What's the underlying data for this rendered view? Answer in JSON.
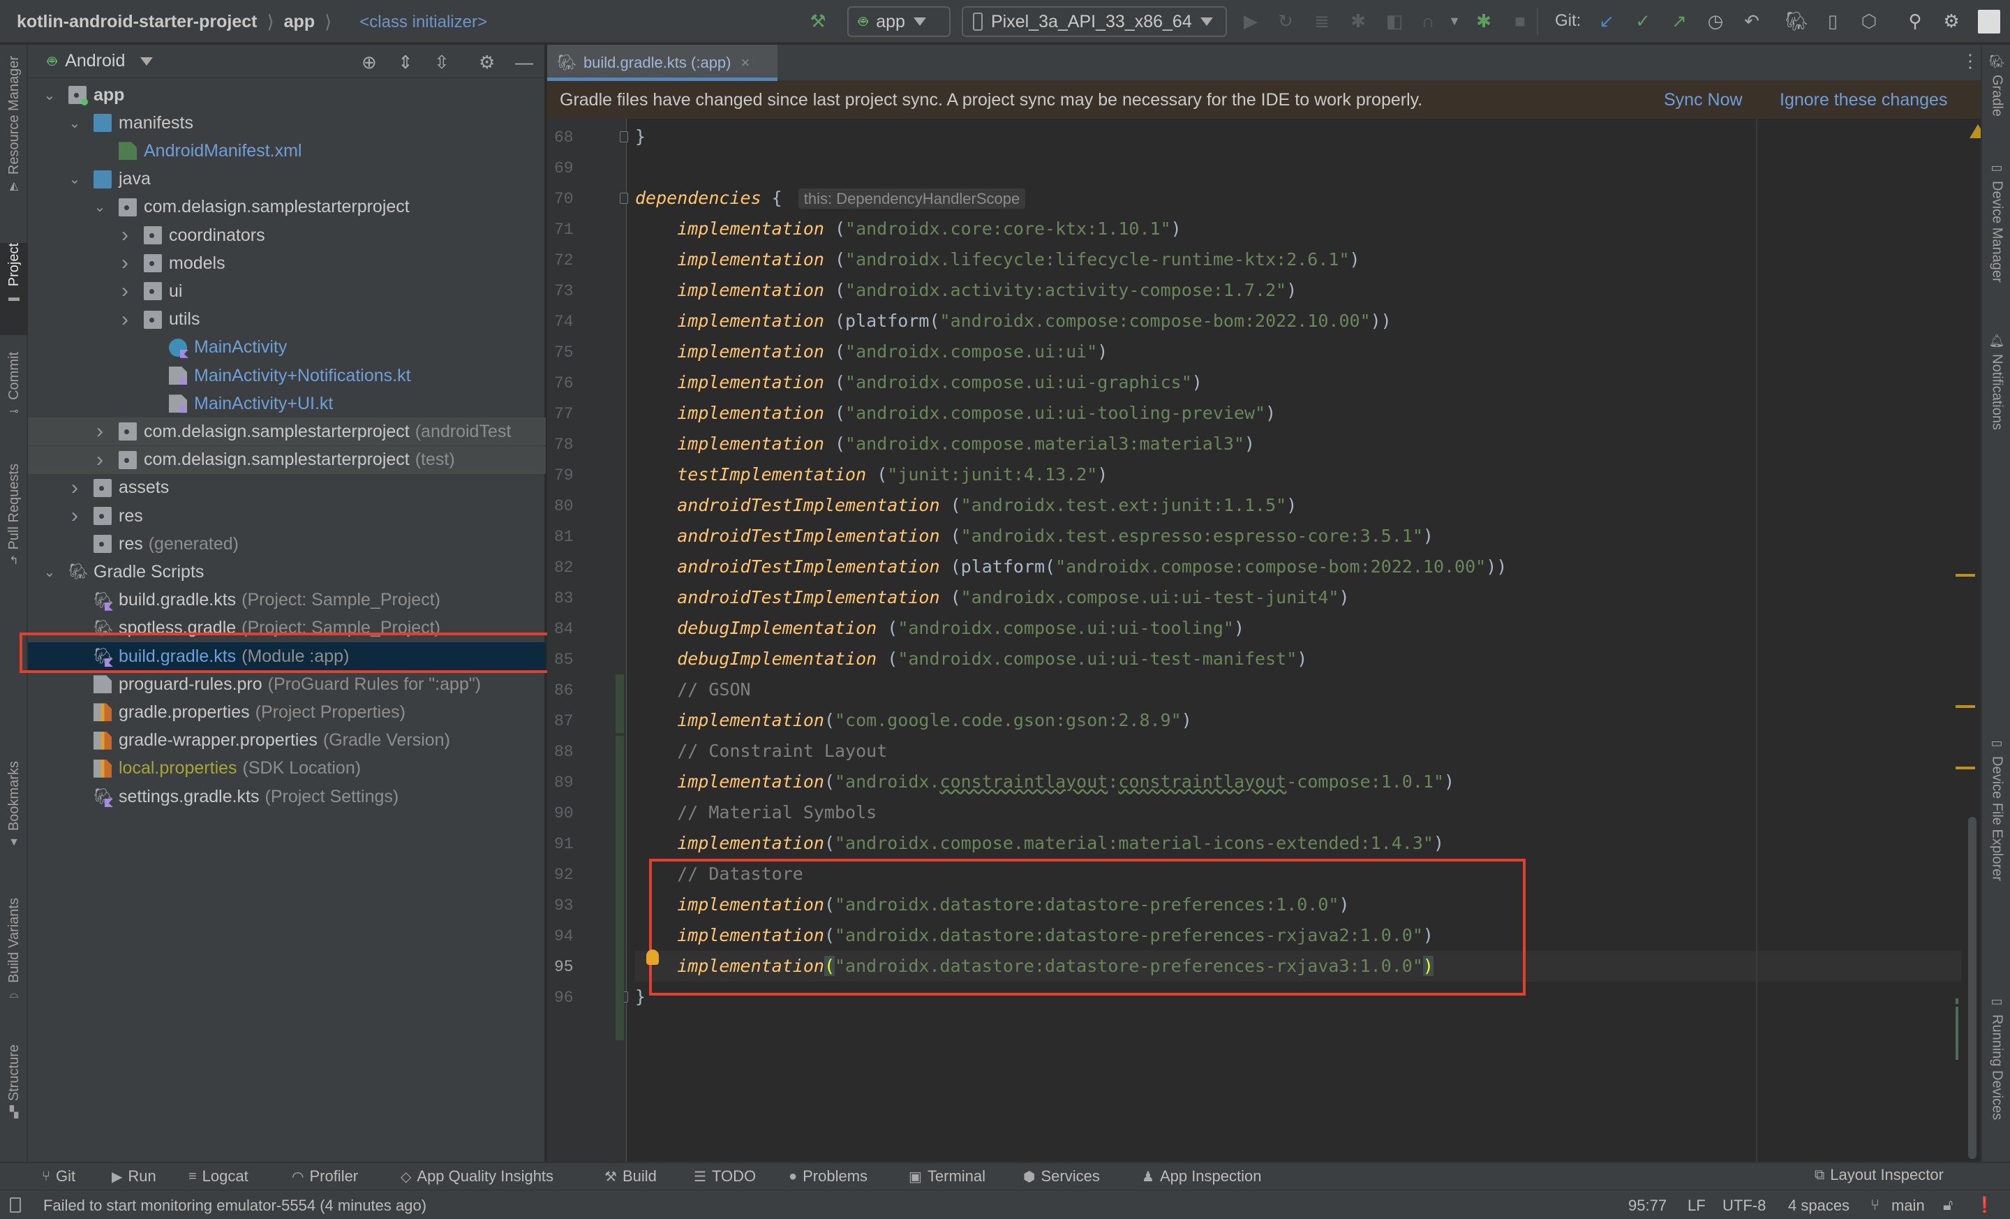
{
  "toolbar": {
    "breadcrumbs": [
      "kotlin-android-starter-project",
      "app"
    ],
    "context": "<class initializer>",
    "run_config": "app",
    "device": "Pixel_3a_API_33_x86_64",
    "git_label": "Git:",
    "icons": [
      "hammer-icon",
      "run-icon",
      "rerun-icon",
      "apply-changes-icon",
      "debug-icon",
      "profile-icon",
      "attach-icon",
      "stop-icon",
      "git-update-icon",
      "git-commit-icon",
      "git-push-icon",
      "history-icon",
      "rollback-icon",
      "gradle-sync-icon",
      "device-manager-icon",
      "sdk-manager-icon",
      "search-icon",
      "settings-icon",
      "avatar"
    ]
  },
  "left_strip": [
    "Resource Manager",
    "Project",
    "Commit",
    "Pull Requests",
    "Bookmarks",
    "Build Variants",
    "Structure"
  ],
  "right_strip": [
    "Gradle",
    "Device Manager",
    "Notifications",
    "Device File Explorer",
    "Running Devices"
  ],
  "project": {
    "view": "Android",
    "tree": [
      {
        "label": "app",
        "sub": "",
        "depth": 0,
        "chev": "down",
        "icon": "module",
        "bold": true
      },
      {
        "label": "manifests",
        "sub": "",
        "depth": 1,
        "chev": "down",
        "icon": "folder"
      },
      {
        "label": "AndroidManifest.xml",
        "sub": "",
        "depth": 2,
        "chev": "",
        "icon": "manifest",
        "style": "blue"
      },
      {
        "label": "java",
        "sub": "",
        "depth": 1,
        "chev": "down",
        "icon": "folder"
      },
      {
        "label": "com.delasign.samplestarterproject",
        "sub": "",
        "depth": 2,
        "chev": "down",
        "icon": "package"
      },
      {
        "label": "coordinators",
        "sub": "",
        "depth": 3,
        "chev": "right",
        "icon": "package"
      },
      {
        "label": "models",
        "sub": "",
        "depth": 3,
        "chev": "right",
        "icon": "package"
      },
      {
        "label": "ui",
        "sub": "",
        "depth": 3,
        "chev": "right",
        "icon": "package"
      },
      {
        "label": "utils",
        "sub": "",
        "depth": 3,
        "chev": "right",
        "icon": "package"
      },
      {
        "label": "MainActivity",
        "sub": "",
        "depth": 4,
        "chev": "",
        "icon": "kotlin-class",
        "style": "blue"
      },
      {
        "label": "MainActivity+Notifications.kt",
        "sub": "",
        "depth": 4,
        "chev": "",
        "icon": "kotlin-file",
        "style": "blue"
      },
      {
        "label": "MainActivity+UI.kt",
        "sub": "",
        "depth": 4,
        "chev": "",
        "icon": "kotlin-file",
        "style": "blue"
      },
      {
        "label": "com.delasign.samplestarterproject",
        "sub": "(androidTest",
        "depth": 2,
        "chev": "right",
        "icon": "package",
        "shaded": true
      },
      {
        "label": "com.delasign.samplestarterproject",
        "sub": "(test)",
        "depth": 2,
        "chev": "right",
        "icon": "package",
        "shaded": true
      },
      {
        "label": "assets",
        "sub": "",
        "depth": 1,
        "chev": "right",
        "icon": "res-folder"
      },
      {
        "label": "res",
        "sub": "",
        "depth": 1,
        "chev": "right",
        "icon": "res-folder"
      },
      {
        "label": "res",
        "sub": "(generated)",
        "depth": 1,
        "chev": "",
        "icon": "res-folder"
      },
      {
        "label": "Gradle Scripts",
        "sub": "",
        "depth": 0,
        "chev": "down",
        "icon": "gradle"
      },
      {
        "label": "build.gradle.kts",
        "sub": "(Project: Sample_Project)",
        "depth": 1,
        "chev": "",
        "icon": "gradle-kts"
      },
      {
        "label": "spotless.gradle",
        "sub": "(Project: Sample_Project)",
        "depth": 1,
        "chev": "",
        "icon": "gradle"
      },
      {
        "label": "build.gradle.kts",
        "sub": "(Module :app)",
        "depth": 1,
        "chev": "",
        "icon": "gradle-kts",
        "selected": true,
        "style": "blue"
      },
      {
        "label": "proguard-rules.pro",
        "sub": "(ProGuard Rules for \":app\")",
        "depth": 1,
        "chev": "",
        "icon": "text-file"
      },
      {
        "label": "gradle.properties",
        "sub": "(Project Properties)",
        "depth": 1,
        "chev": "",
        "icon": "properties"
      },
      {
        "label": "gradle-wrapper.properties",
        "sub": "(Gradle Version)",
        "depth": 1,
        "chev": "",
        "icon": "properties"
      },
      {
        "label": "local.properties",
        "sub": "(SDK Location)",
        "depth": 1,
        "chev": "",
        "icon": "properties",
        "style": "olive"
      },
      {
        "label": "settings.gradle.kts",
        "sub": "(Project Settings)",
        "depth": 1,
        "chev": "",
        "icon": "gradle-kts"
      }
    ]
  },
  "editor": {
    "tab": "build.gradle.kts (:app)",
    "banner": {
      "message": "Gradle files have changed since last project sync. A project sync may be necessary for the IDE to work properly.",
      "sync_now": "Sync Now",
      "ignore": "Ignore these changes"
    },
    "current_line": 95,
    "lines": [
      {
        "n": 68,
        "parts": [
          [
            "p",
            "}"
          ]
        ]
      },
      {
        "n": 69,
        "parts": []
      },
      {
        "n": 70,
        "parts": [
          [
            "kw",
            "dependencies"
          ],
          [
            "p",
            " { "
          ],
          [
            "hint",
            "this: DependencyHandlerScope"
          ]
        ]
      },
      {
        "n": 71,
        "parts": [
          [
            "p",
            "    "
          ],
          [
            "kw",
            "implementation"
          ],
          [
            "p",
            " ("
          ],
          [
            "str",
            "\"androidx.core:core-ktx:1.10.1\""
          ],
          [
            "p",
            ")"
          ]
        ]
      },
      {
        "n": 72,
        "parts": [
          [
            "p",
            "    "
          ],
          [
            "kw",
            "implementation"
          ],
          [
            "p",
            " ("
          ],
          [
            "str",
            "\"androidx.lifecycle:lifecycle-runtime-ktx:2.6.1\""
          ],
          [
            "p",
            ")"
          ]
        ]
      },
      {
        "n": 73,
        "parts": [
          [
            "p",
            "    "
          ],
          [
            "kw",
            "implementation"
          ],
          [
            "p",
            " ("
          ],
          [
            "str",
            "\"androidx.activity:activity-compose:1.7.2\""
          ],
          [
            "p",
            ")"
          ]
        ]
      },
      {
        "n": 74,
        "parts": [
          [
            "p",
            "    "
          ],
          [
            "kw",
            "implementation"
          ],
          [
            "p",
            " (platform("
          ],
          [
            "str",
            "\"androidx.compose:compose-bom:2022.10.00\""
          ],
          [
            "p",
            "))"
          ]
        ]
      },
      {
        "n": 75,
        "parts": [
          [
            "p",
            "    "
          ],
          [
            "kw",
            "implementation"
          ],
          [
            "p",
            " ("
          ],
          [
            "str",
            "\"androidx.compose.ui:ui\""
          ],
          [
            "p",
            ")"
          ]
        ]
      },
      {
        "n": 76,
        "parts": [
          [
            "p",
            "    "
          ],
          [
            "kw",
            "implementation"
          ],
          [
            "p",
            " ("
          ],
          [
            "str",
            "\"androidx.compose.ui:ui-graphics\""
          ],
          [
            "p",
            ")"
          ]
        ]
      },
      {
        "n": 77,
        "parts": [
          [
            "p",
            "    "
          ],
          [
            "kw",
            "implementation"
          ],
          [
            "p",
            " ("
          ],
          [
            "str",
            "\"androidx.compose.ui:ui-tooling-preview\""
          ],
          [
            "p",
            ")"
          ]
        ]
      },
      {
        "n": 78,
        "parts": [
          [
            "p",
            "    "
          ],
          [
            "kw",
            "implementation"
          ],
          [
            "p",
            " ("
          ],
          [
            "str",
            "\"androidx.compose.material3:material3\""
          ],
          [
            "p",
            ")"
          ]
        ]
      },
      {
        "n": 79,
        "parts": [
          [
            "p",
            "    "
          ],
          [
            "kw",
            "testImplementation"
          ],
          [
            "p",
            " ("
          ],
          [
            "str",
            "\"junit:junit:4.13.2\""
          ],
          [
            "p",
            ")"
          ]
        ]
      },
      {
        "n": 80,
        "parts": [
          [
            "p",
            "    "
          ],
          [
            "kw",
            "androidTestImplementation"
          ],
          [
            "p",
            " ("
          ],
          [
            "str",
            "\"androidx.test.ext:junit:1.1.5\""
          ],
          [
            "p",
            ")"
          ]
        ]
      },
      {
        "n": 81,
        "parts": [
          [
            "p",
            "    "
          ],
          [
            "kw",
            "androidTestImplementation"
          ],
          [
            "p",
            " ("
          ],
          [
            "str",
            "\"androidx.test.espresso:espresso-core:3.5.1\""
          ],
          [
            "p",
            ")"
          ]
        ]
      },
      {
        "n": 82,
        "parts": [
          [
            "p",
            "    "
          ],
          [
            "kw",
            "androidTestImplementation"
          ],
          [
            "p",
            " (platform("
          ],
          [
            "str",
            "\"androidx.compose:compose-bom:2022.10.00\""
          ],
          [
            "p",
            "))"
          ]
        ]
      },
      {
        "n": 83,
        "parts": [
          [
            "p",
            "    "
          ],
          [
            "kw",
            "androidTestImplementation"
          ],
          [
            "p",
            " ("
          ],
          [
            "str",
            "\"androidx.compose.ui:ui-test-junit4\""
          ],
          [
            "p",
            ")"
          ]
        ]
      },
      {
        "n": 84,
        "parts": [
          [
            "p",
            "    "
          ],
          [
            "kw",
            "debugImplementation"
          ],
          [
            "p",
            " ("
          ],
          [
            "str",
            "\"androidx.compose.ui:ui-tooling\""
          ],
          [
            "p",
            ")"
          ]
        ]
      },
      {
        "n": 85,
        "parts": [
          [
            "p",
            "    "
          ],
          [
            "kw",
            "debugImplementation"
          ],
          [
            "p",
            " ("
          ],
          [
            "str",
            "\"androidx.compose.ui:ui-test-manifest\""
          ],
          [
            "p",
            ")"
          ]
        ]
      },
      {
        "n": 86,
        "parts": [
          [
            "p",
            "    "
          ],
          [
            "cmt",
            "// GSON"
          ]
        ]
      },
      {
        "n": 87,
        "parts": [
          [
            "p",
            "    "
          ],
          [
            "kw",
            "implementation"
          ],
          [
            "p",
            "("
          ],
          [
            "str",
            "\"com.google.code.gson:gson:2.8.9\""
          ],
          [
            "p",
            ")"
          ]
        ]
      },
      {
        "n": 88,
        "parts": [
          [
            "p",
            "    "
          ],
          [
            "cmt",
            "// Constraint Layout"
          ]
        ]
      },
      {
        "n": 89,
        "parts": [
          [
            "p",
            "    "
          ],
          [
            "kw",
            "implementation"
          ],
          [
            "p",
            "("
          ],
          [
            "str",
            "\"androidx."
          ],
          [
            "squig",
            "constraintlayout"
          ],
          [
            "str",
            ":"
          ],
          [
            "squig",
            "constraintlayout"
          ],
          [
            "str",
            "-compose:1.0.1\""
          ],
          [
            "p",
            ")"
          ]
        ]
      },
      {
        "n": 90,
        "parts": [
          [
            "p",
            "    "
          ],
          [
            "cmt",
            "// Material Symbols"
          ]
        ]
      },
      {
        "n": 91,
        "parts": [
          [
            "p",
            "    "
          ],
          [
            "kw",
            "implementation"
          ],
          [
            "p",
            "("
          ],
          [
            "str",
            "\"androidx.compose.material:material-icons-extended:1.4.3\""
          ],
          [
            "p",
            ")"
          ]
        ]
      },
      {
        "n": 92,
        "parts": [
          [
            "p",
            "    "
          ],
          [
            "cmt",
            "// Datastore"
          ]
        ]
      },
      {
        "n": 93,
        "parts": [
          [
            "p",
            "    "
          ],
          [
            "kw",
            "implementation"
          ],
          [
            "p",
            "("
          ],
          [
            "str",
            "\"androidx.datastore:datastore-preferences:1.0.0\""
          ],
          [
            "p",
            ")"
          ]
        ]
      },
      {
        "n": 94,
        "parts": [
          [
            "p",
            "    "
          ],
          [
            "kw",
            "implementation"
          ],
          [
            "p",
            "("
          ],
          [
            "str",
            "\"androidx.datastore:datastore-preferences-rxjava2:1.0.0\""
          ],
          [
            "p",
            ")"
          ]
        ]
      },
      {
        "n": 95,
        "parts": [
          [
            "p",
            "    "
          ],
          [
            "kw",
            "implementation"
          ],
          [
            "bh",
            "("
          ],
          [
            "str",
            "\"androidx.datastore:datastore-preferences-rxjava3:1.0.0\""
          ],
          [
            "bh",
            ")"
          ]
        ]
      },
      {
        "n": 96,
        "parts": [
          [
            "p",
            "}"
          ]
        ]
      }
    ]
  },
  "bottom_tools": [
    {
      "label": "Git",
      "icon": "git-branch-icon",
      "glyph": "⑂"
    },
    {
      "label": "Run",
      "icon": "run-icon",
      "glyph": "▶"
    },
    {
      "label": "Logcat",
      "icon": "logcat-icon",
      "glyph": "≡"
    },
    {
      "label": "Profiler",
      "icon": "profiler-icon",
      "glyph": "◠"
    },
    {
      "label": "App Quality Insights",
      "icon": "diamond-icon",
      "glyph": "◇"
    },
    {
      "label": "Build",
      "icon": "hammer-icon",
      "glyph": "⚒"
    },
    {
      "label": "TODO",
      "icon": "list-icon",
      "glyph": "☰"
    },
    {
      "label": "Problems",
      "icon": "problems-icon",
      "glyph": "●"
    },
    {
      "label": "Terminal",
      "icon": "terminal-icon",
      "glyph": "▣"
    },
    {
      "label": "Services",
      "icon": "services-icon",
      "glyph": "⬢"
    },
    {
      "label": "App Inspection",
      "icon": "app-inspection-icon",
      "glyph": "♟"
    }
  ],
  "layout_inspector": "Layout Inspector",
  "status": {
    "message": "Failed to start monitoring emulator-5554 (4 minutes ago)",
    "position": "95:77",
    "line_sep": "LF",
    "encoding": "UTF-8",
    "indent": "4 spaces",
    "branch": "main"
  }
}
